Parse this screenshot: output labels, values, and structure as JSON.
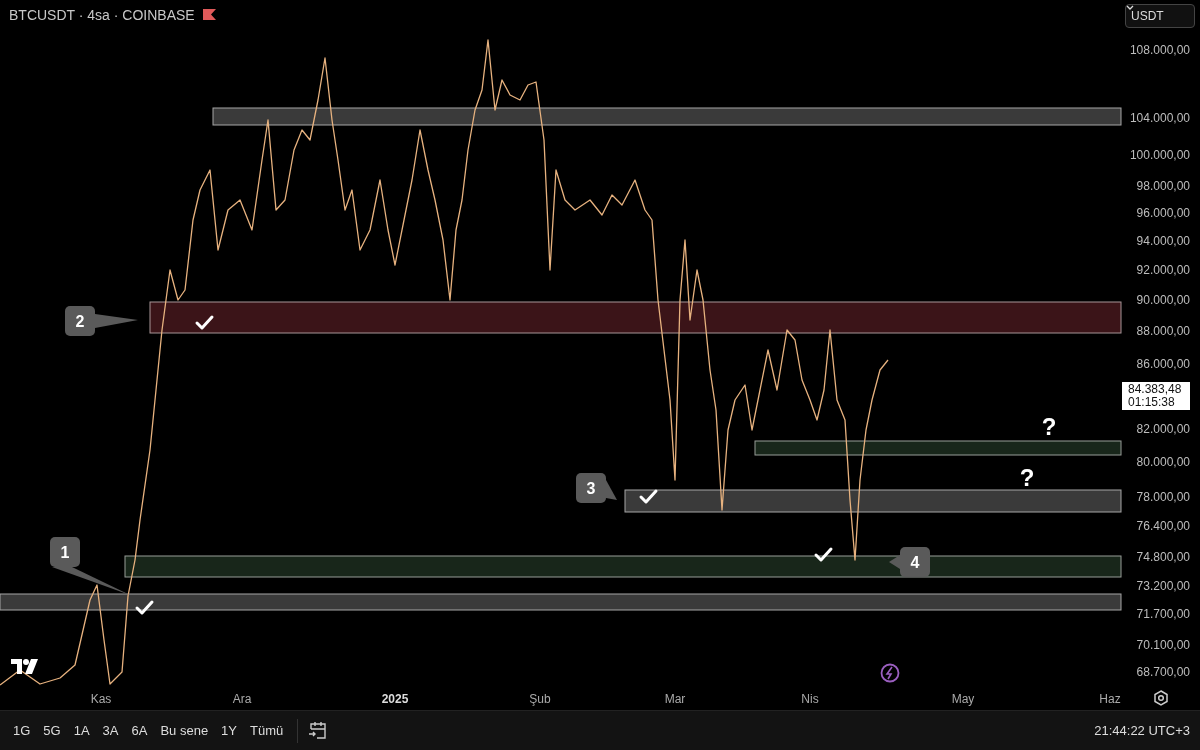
{
  "header": {
    "title": "BTCUSDT · 4sa · COINBASE"
  },
  "currency_selector": {
    "value": "USDT"
  },
  "price_axis": {
    "ticks": [
      "108.000,00",
      "104.000,00",
      "100.000,00",
      "98.000,00",
      "96.000,00",
      "94.000,00",
      "92.000,00",
      "90.000,00",
      "88.000,00",
      "86.000,00",
      "82.000,00",
      "80.000,00",
      "78.000,00",
      "76.400,00",
      "74.800,00",
      "73.200,00",
      "71.700,00",
      "70.100,00",
      "68.700,00"
    ],
    "current_price": "84.383,48",
    "countdown": "01:15:38"
  },
  "time_axis": {
    "labels": [
      {
        "text": "Kas",
        "kind": "month"
      },
      {
        "text": "Ara",
        "kind": "month"
      },
      {
        "text": "2025",
        "kind": "year"
      },
      {
        "text": "Şub",
        "kind": "month"
      },
      {
        "text": "Mar",
        "kind": "month"
      },
      {
        "text": "Nis",
        "kind": "month"
      },
      {
        "text": "May",
        "kind": "month"
      },
      {
        "text": "Haz",
        "kind": "month"
      }
    ]
  },
  "zones": [
    {
      "color": "#3a3a3a"
    },
    {
      "color": "#3b1418"
    },
    {
      "color": "#18261a"
    },
    {
      "color": "#3a3a3a"
    },
    {
      "color": "#18261a"
    },
    {
      "color": "#3a3a3a"
    }
  ],
  "callouts": [
    {
      "label": "1"
    },
    {
      "label": "2"
    },
    {
      "label": "3"
    },
    {
      "label": "4"
    }
  ],
  "question_marks": [
    {
      "text": "?"
    },
    {
      "text": "?"
    }
  ],
  "range_buttons": [
    {
      "label": "1G",
      "selected": false
    },
    {
      "label": "5G",
      "selected": false
    },
    {
      "label": "1A",
      "selected": false
    },
    {
      "label": "3A",
      "selected": false
    },
    {
      "label": "6A",
      "selected": false
    },
    {
      "label": "Bu sene",
      "selected": false
    },
    {
      "label": "1Y",
      "selected": false
    },
    {
      "label": "Tümü",
      "selected": false
    }
  ],
  "clock": "21:44:22 UTC+3"
}
